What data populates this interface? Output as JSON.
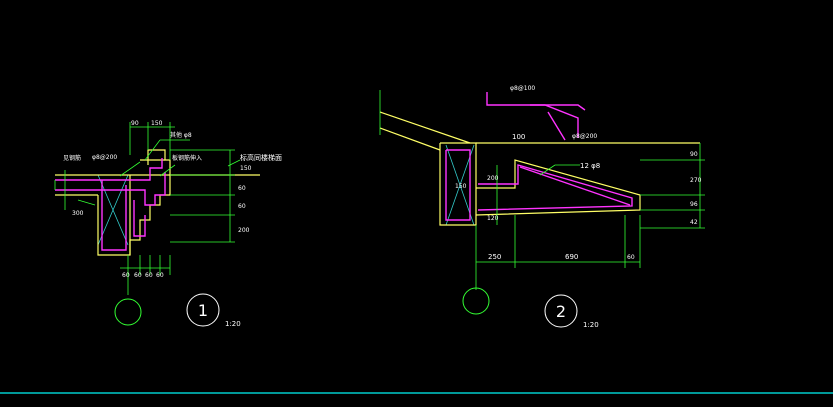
{
  "colors": {
    "background": "#000000",
    "outline": "#ffff66",
    "rebar": "#ff33ff",
    "dimension": "#33ff33",
    "hatch": "#33cccc",
    "label": "#ffffff",
    "bottom_line": "#00cccc"
  },
  "detail1": {
    "dims_top": [
      "90",
      "150"
    ],
    "dims_right": [
      "150",
      "60",
      "60",
      "200"
    ],
    "dims_bottom": [
      "60",
      "60",
      "60",
      "60"
    ],
    "dim_left": "300",
    "rebar_label_1": "φ8@200",
    "rebar_label_2": "其他 φ8",
    "label_left": "见钢筋",
    "label_mid": "板钢筋伸入",
    "label_right": "标高同楼梯面",
    "axis_label": "",
    "number": "1",
    "scale": "1:20"
  },
  "detail2": {
    "rebar_label_top": "φ8@100",
    "rebar_label_mid": "φ8@200",
    "dim_100": "100",
    "bar_label": "12 φ8",
    "dims_left": [
      "150",
      "200",
      "120"
    ],
    "dims_right": [
      "90",
      "270",
      "96",
      "42"
    ],
    "dims_bottom": [
      "250",
      "690",
      "60"
    ],
    "axis_label": "",
    "number": "2",
    "scale": "1:20"
  }
}
